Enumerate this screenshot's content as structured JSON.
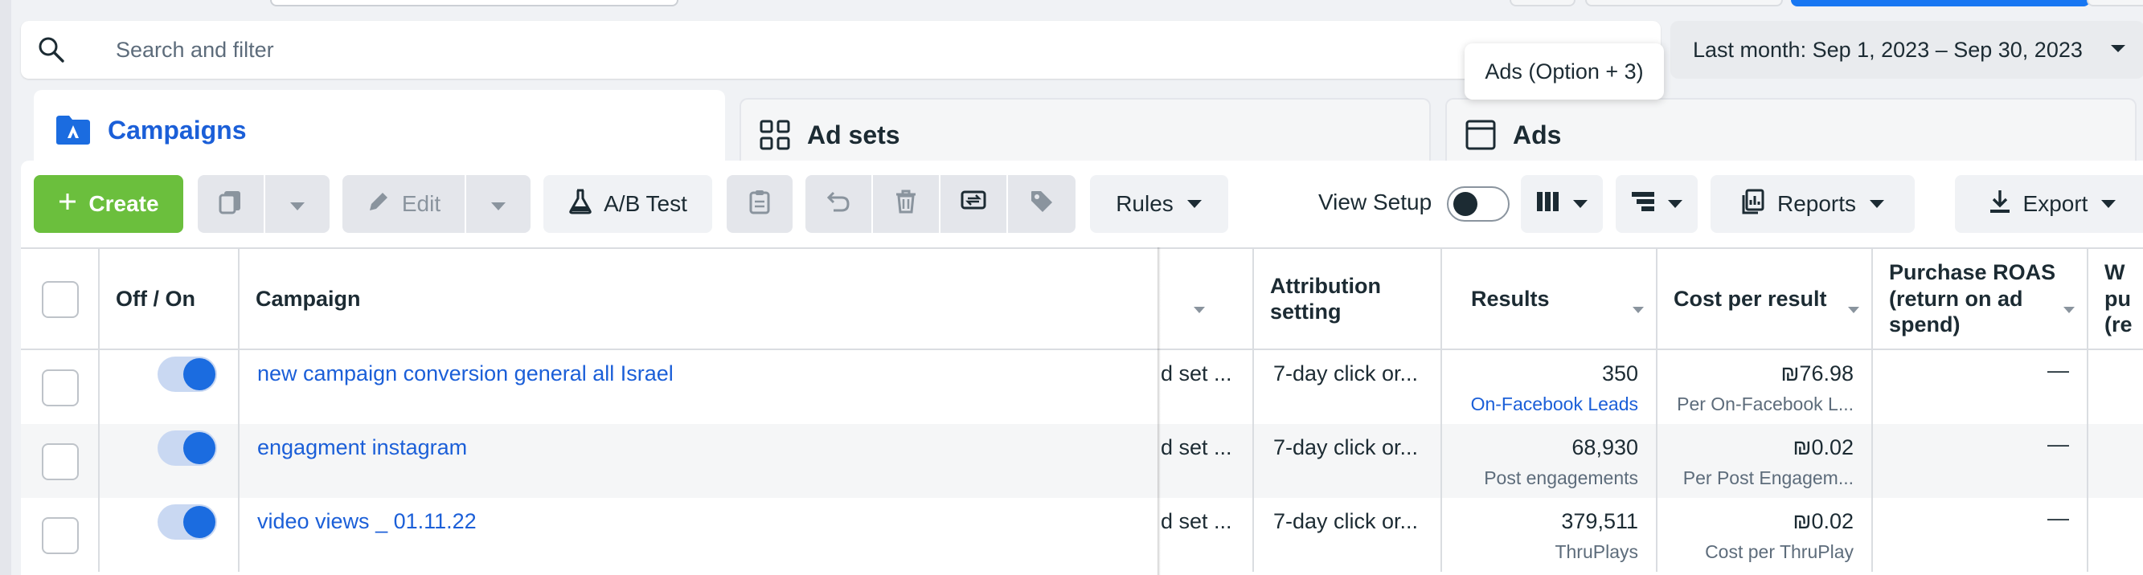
{
  "search": {
    "placeholder": "Search and filter"
  },
  "date_range": {
    "label": "Last month: Sep 1, 2023 – Sep 30, 2023"
  },
  "tooltip": {
    "text": "Ads (Option + 3)"
  },
  "tabs": [
    {
      "label": "Campaigns",
      "icon": "folder-icon",
      "active": true
    },
    {
      "label": "Ad sets",
      "icon": "grid-icon",
      "active": false
    },
    {
      "label": "Ads",
      "icon": "window-icon",
      "active": false
    }
  ],
  "toolbar": {
    "create": "Create",
    "edit": "Edit",
    "ab_test": "A/B Test",
    "rules": "Rules",
    "view_setup": "View Setup",
    "reports": "Reports",
    "export": "Export"
  },
  "table": {
    "headers": {
      "toggle": "Off / On",
      "campaign": "Campaign",
      "attribution_line1": "Attribution",
      "attribution_line2": "setting",
      "results": "Results",
      "cost_per_result": "Cost per result",
      "roas_line1": "Purchase ROAS",
      "roas_line2": "(return on ad",
      "roas_line3": "spend)",
      "next_line1": "W",
      "next_line2": "pu",
      "next_line3": "(re"
    },
    "rows": [
      {
        "campaign": "new campaign conversion general all Israel",
        "ad_set": "d set ...",
        "attribution": "7-day click or...",
        "results": "350",
        "results_sub": "On-Facebook Leads",
        "cost": "₪76.98",
        "cost_sub": "Per On-Facebook L...",
        "roas": "—"
      },
      {
        "campaign": "engagment instagram",
        "ad_set": "d set ...",
        "attribution": "7-day click or...",
        "results": "68,930",
        "results_sub": "Post engagements",
        "cost": "₪0.02",
        "cost_sub": "Per Post Engagem...",
        "roas": "—"
      },
      {
        "campaign": "video views _ 01.11.22",
        "ad_set": "d set ...",
        "attribution": "7-day click or...",
        "results": "379,511",
        "results_sub": "ThruPlays",
        "cost": "₪0.02",
        "cost_sub": "Cost per ThruPlay",
        "roas": "—"
      }
    ]
  },
  "colors": {
    "accent": "#1b5fd8",
    "create": "#6bbf3d",
    "primary": "#1877f2"
  }
}
